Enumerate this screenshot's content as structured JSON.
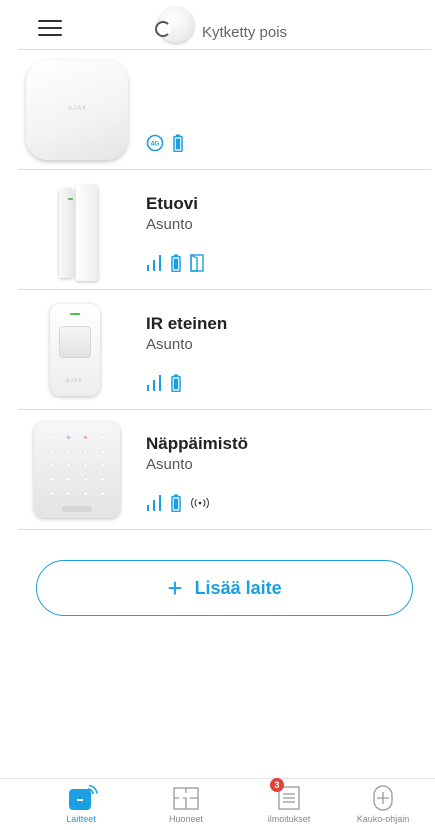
{
  "header": {
    "menu_icon": "hamburger-icon",
    "status_icon": "hub-disconnected-icon",
    "status_text": "Kytketty pois"
  },
  "devices": [
    {
      "kind": "hub",
      "name": "",
      "room": "",
      "icons": [
        "4g-icon",
        "battery-icon"
      ]
    },
    {
      "kind": "door",
      "name": "Etuovi",
      "room": "Asunto",
      "icons": [
        "signal-icon",
        "battery-icon",
        "door-open-icon"
      ]
    },
    {
      "kind": "motion",
      "name": "IR eteinen",
      "room": "Asunto",
      "icons": [
        "signal-icon",
        "battery-icon"
      ]
    },
    {
      "kind": "keypad",
      "name": "Näppäimistö",
      "room": "Asunto",
      "icons": [
        "signal-icon",
        "battery-icon",
        "wireless-icon"
      ]
    }
  ],
  "hub_badge": "4G",
  "add_device": {
    "plus": "+",
    "label": "Lisää laite"
  },
  "nav": [
    {
      "label": "Laitteet",
      "icon": "devices-icon",
      "active": true
    },
    {
      "label": "Huoneet",
      "icon": "rooms-icon",
      "active": false
    },
    {
      "label": "ilmoitukset",
      "icon": "notifications-icon",
      "active": false,
      "badge": "3"
    },
    {
      "label": "Kauko-ohjain",
      "icon": "remote-control-icon",
      "active": false
    }
  ],
  "colors": {
    "accent": "#1a9fe0",
    "badge": "#e0423a",
    "divider": "#dcdcdc"
  }
}
